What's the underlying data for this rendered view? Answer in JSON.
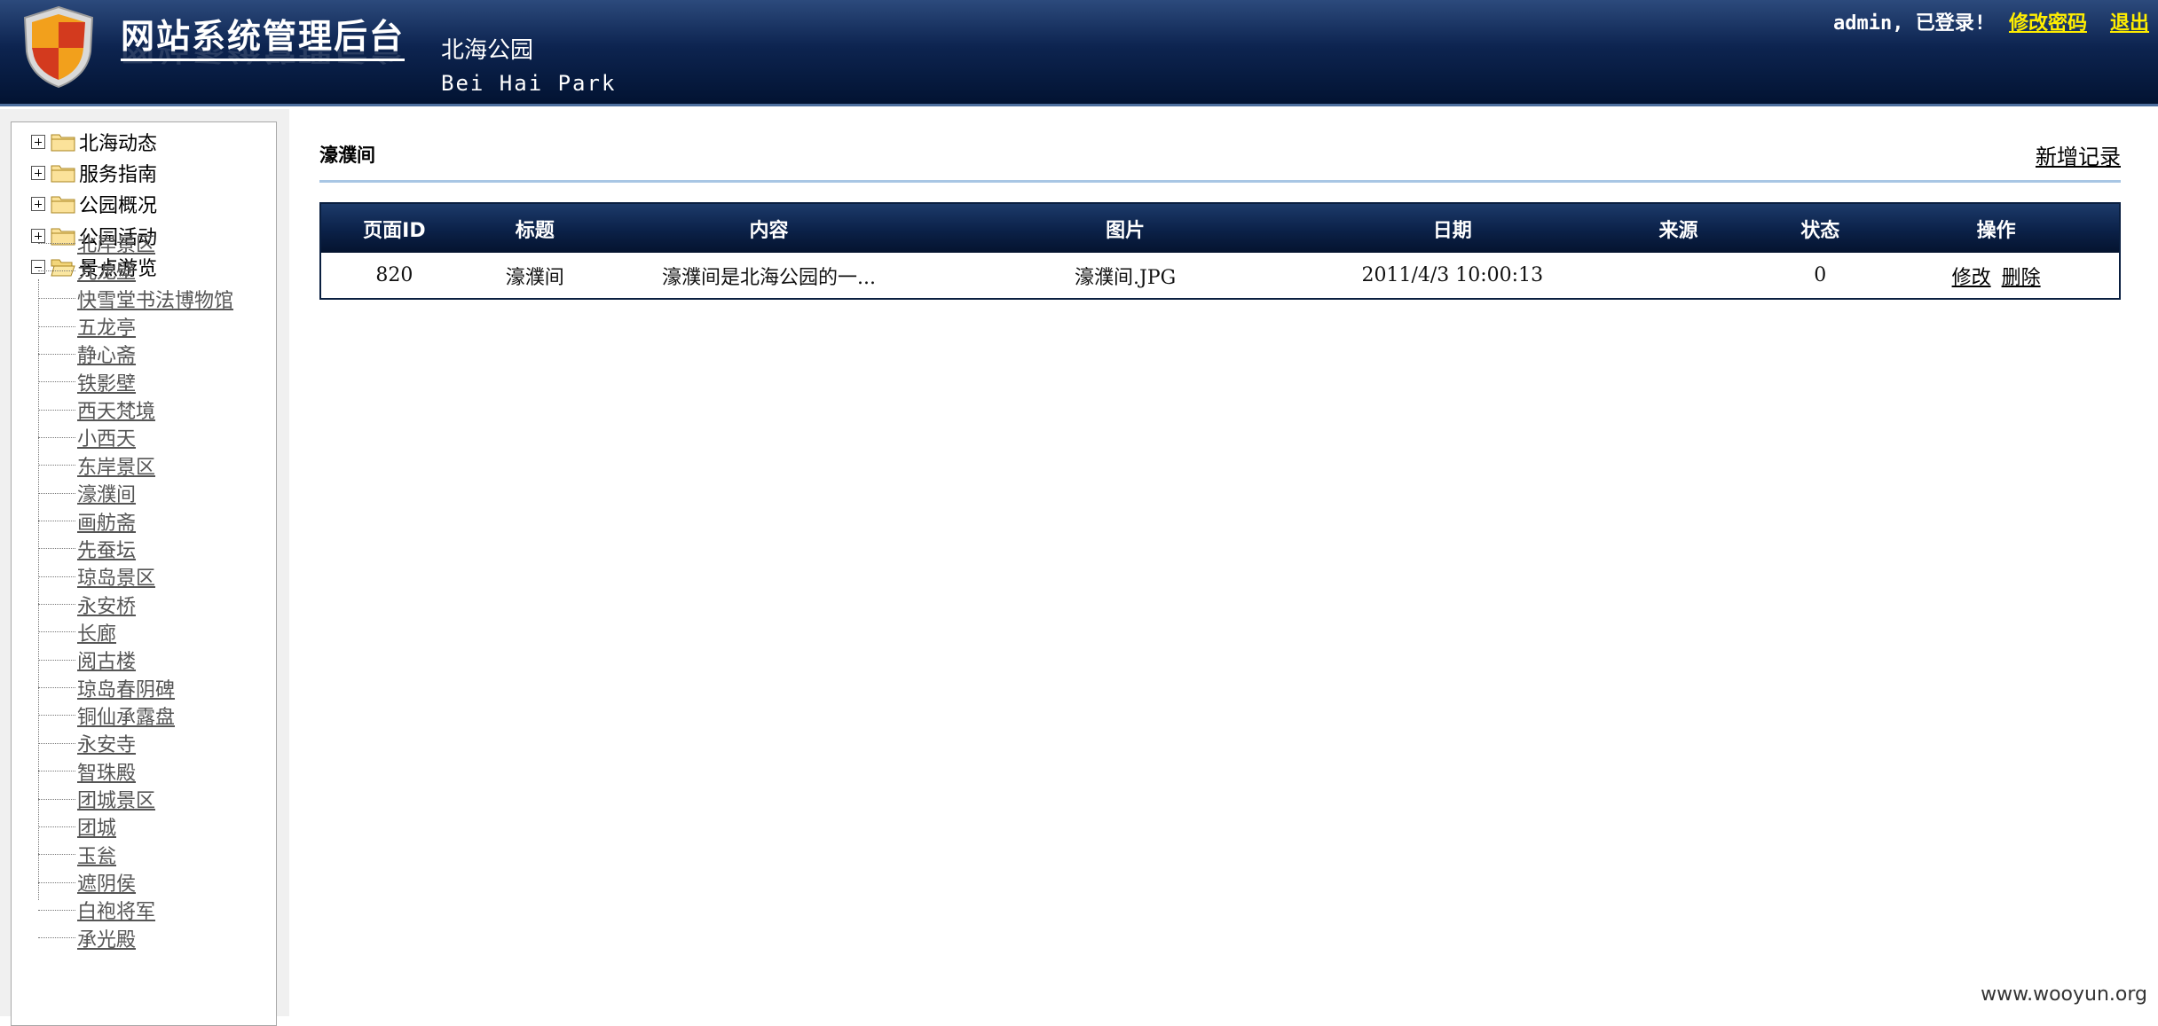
{
  "header": {
    "site_title": "网站系统管理后台",
    "park_name_cn": "北海公园",
    "park_name_en": "Bei Hai Park",
    "login_status": "admin, 已登录!",
    "change_password": "修改密码",
    "logout": "退出"
  },
  "sidebar": {
    "roots": [
      {
        "label": "北海动态",
        "expanded": false
      },
      {
        "label": "服务指南",
        "expanded": false
      },
      {
        "label": "公园概况",
        "expanded": false
      },
      {
        "label": "公园活动",
        "expanded": false
      },
      {
        "label": "景点游览",
        "expanded": true
      }
    ],
    "children": [
      "北岸景区",
      "九龙壁",
      "快雪堂书法博物馆",
      "五龙亭",
      "静心斋",
      "铁影壁",
      "西天梵境",
      "小西天",
      "东岸景区",
      "濠濮间",
      "画舫斋",
      "先蚕坛",
      "琼岛景区",
      "永安桥",
      "长廊",
      "阅古楼",
      "琼岛春阴碑",
      "铜仙承露盘",
      "永安寺",
      "智珠殿",
      "团城景区",
      "团城",
      "玉瓮",
      "遮阴侯",
      "白袍将军",
      "承光殿"
    ]
  },
  "main": {
    "page_title": "濠濮间",
    "add_record": "新增记录",
    "table": {
      "columns": [
        "页面ID",
        "标题",
        "内容",
        "图片",
        "日期",
        "来源",
        "状态",
        "操作"
      ],
      "rows": [
        {
          "id": "820",
          "title": "濠濮间",
          "content": "濠濮间是北海公园的一...",
          "image": "濠濮间.JPG",
          "date": "2011/4/3 10:00:13",
          "source": "",
          "status": "0",
          "edit": "修改",
          "delete": "删除"
        }
      ]
    }
  },
  "watermark": "www.wooyun.org",
  "colors": {
    "header_dark": "#021332",
    "header_light": "#2c4a7c",
    "link_yellow": "#ffee00",
    "rule_blue": "#a8c6e4"
  }
}
